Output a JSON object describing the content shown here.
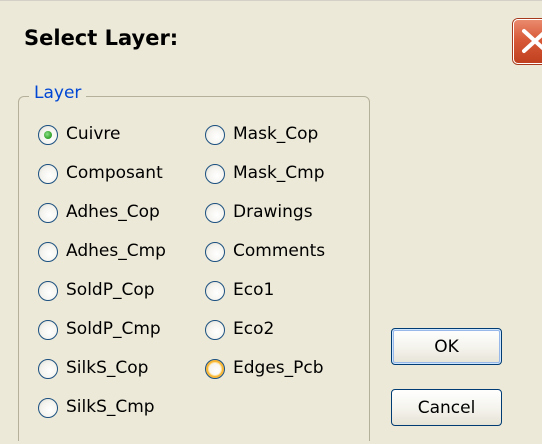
{
  "dialog": {
    "title": "Select Layer:",
    "close_icon": "close-x-icon"
  },
  "group": {
    "label": "Layer",
    "selected": "Cuivre",
    "hovered": "Edges_Pcb"
  },
  "layers_left": [
    "Cuivre",
    "Composant",
    "Adhes_Cop",
    "Adhes_Cmp",
    "SoldP_Cop",
    "SoldP_Cmp",
    "SilkS_Cop",
    "SilkS_Cmp"
  ],
  "layers_right": [
    "Mask_Cop",
    "Mask_Cmp",
    "Drawings",
    "Comments",
    "Eco1",
    "Eco2",
    "Edges_Pcb"
  ],
  "buttons": {
    "ok": "OK",
    "cancel": "Cancel"
  },
  "colors": {
    "group_label": "#0046d5",
    "close_button": "#d85a38",
    "selected_dot": "#3aa832",
    "hover_ring": "#f8b636"
  }
}
